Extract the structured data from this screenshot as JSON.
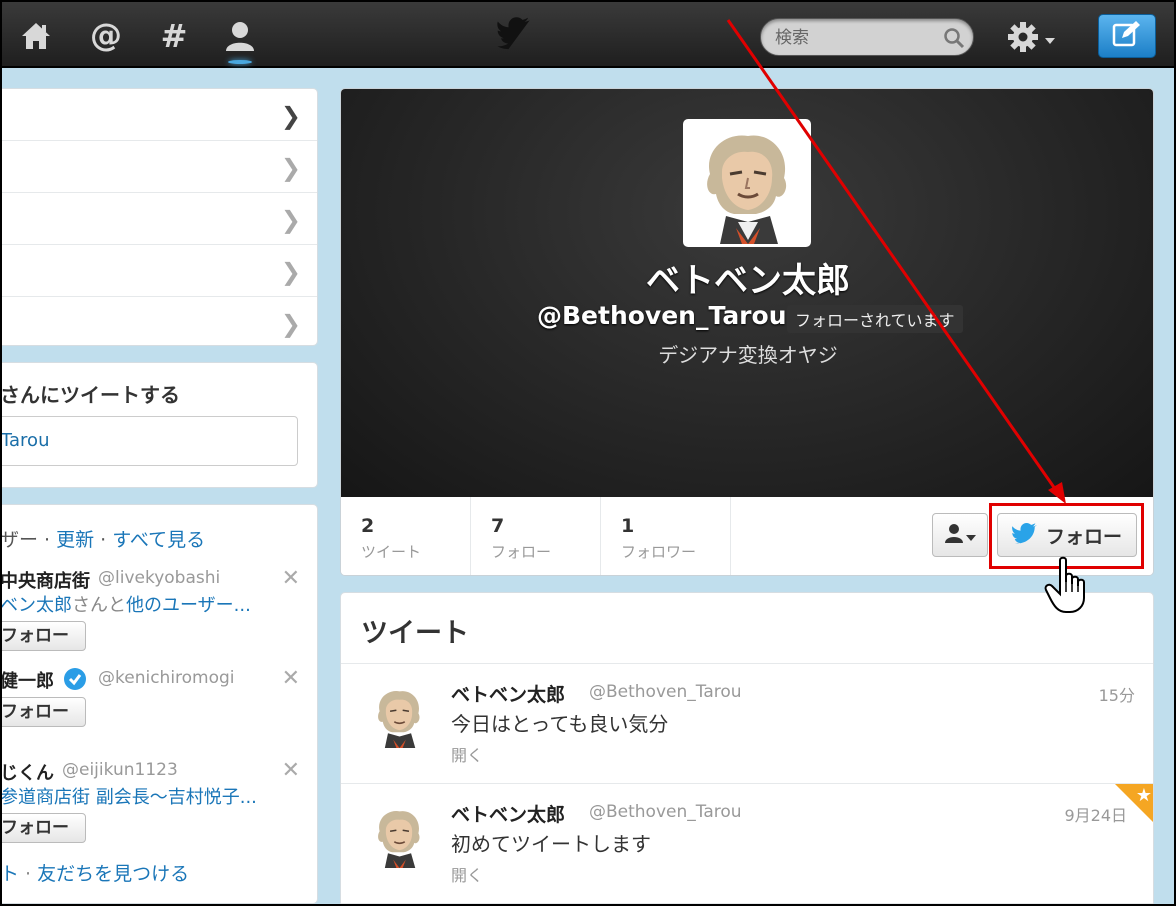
{
  "topbar": {
    "nav_icons": [
      "home-icon",
      "at-mentions-icon",
      "hashtag-discover-icon",
      "profile-icon"
    ],
    "active_nav": "profile-icon",
    "logo": "twitter-bird-icon",
    "search": {
      "placeholder": "検索"
    },
    "settings_icon": "gear-icon",
    "compose_icon": "compose-tweet-icon"
  },
  "sidebar": {
    "nav_rows": 5,
    "tweet_to": {
      "title": "さんにツイートする",
      "input_value": "Tarou"
    },
    "who_to_follow": {
      "heading_prefix": "ザー · ",
      "refresh": "更新",
      "sep": " · ",
      "view_all": "すべて見る",
      "items": [
        {
          "name": "中央商店街",
          "handle": "@livekyobashi",
          "sub_link": "ベン太郎",
          "sub_gray": "さんと",
          "sub_link2": "他のユーザー...",
          "follow_label": "フォロー"
        },
        {
          "name": "健一郎",
          "verified": true,
          "handle": "@kenichiromogi",
          "follow_label": "フォロー"
        },
        {
          "name": "じくん",
          "handle": "@eijikun1123",
          "sub_link": "参道商店街 副会長～吉村悦子...",
          "follow_label": "フォロー"
        }
      ],
      "footer_link1": "ト",
      "footer_sep": " · ",
      "footer_link2": "友だちを見つける"
    }
  },
  "profile": {
    "name": "ベトベン太郎",
    "handle": "@Bethoven_Tarou",
    "follows_you": "フォローされています",
    "bio": "デジアナ変換オヤジ",
    "stats": [
      {
        "value": "2",
        "label": "ツイート"
      },
      {
        "value": "7",
        "label": "フォロー"
      },
      {
        "value": "1",
        "label": "フォロワー"
      }
    ],
    "follow_button": "フォロー"
  },
  "tweets": {
    "title": "ツイート",
    "items": [
      {
        "name": "ベトベン太郎",
        "handle": "@Bethoven_Tarou",
        "time": "15分",
        "text": "今日はとっても良い気分",
        "open": "開く",
        "favorited": false
      },
      {
        "name": "ベトベン太郎",
        "handle": "@Bethoven_Tarou",
        "time": "9月24日",
        "text": "初めてツイートします",
        "open": "開く",
        "favorited": true
      }
    ]
  },
  "colors": {
    "link": "#1a76b8",
    "annotation": "#e00000",
    "compose": "#2a8ad8",
    "verified": "#2a9de6",
    "favorite": "#f5a623"
  }
}
